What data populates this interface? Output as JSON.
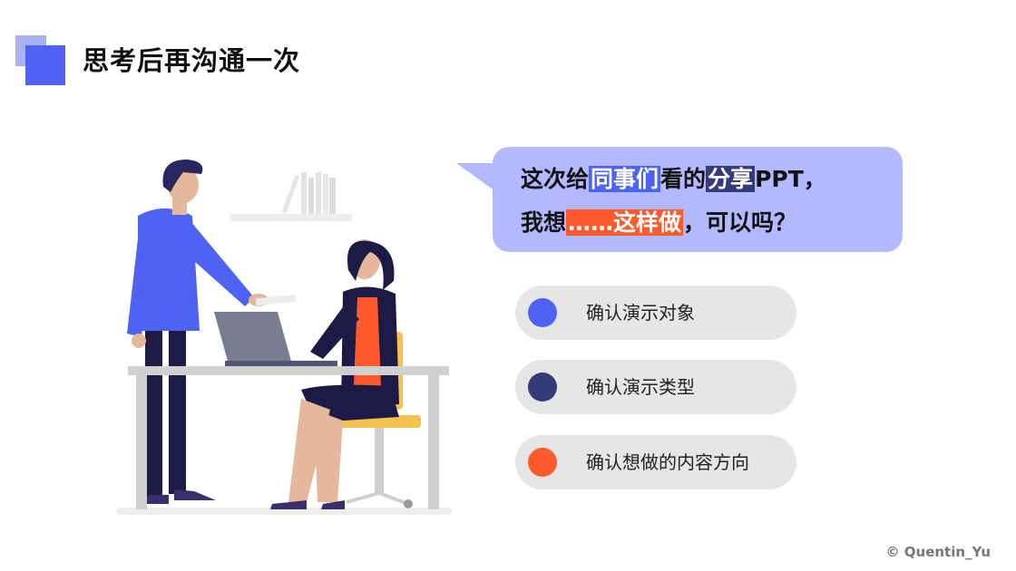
{
  "title": "思考后再沟通一次",
  "bubble": {
    "line1": [
      {
        "text": "这次给"
      },
      {
        "text": "同事们",
        "highlight": "blue"
      },
      {
        "text": "看的"
      },
      {
        "text": "分享",
        "highlight": "navy"
      },
      {
        "text": "PPT，"
      }
    ],
    "line2": [
      {
        "text": "我想"
      },
      {
        "text": "……这样做",
        "highlight": "orange"
      },
      {
        "text": "，可以吗？"
      }
    ]
  },
  "options": [
    {
      "label": "确认演示对象",
      "color": "#4f63f3"
    },
    {
      "label": "确认演示类型",
      "color": "#343b76"
    },
    {
      "label": "确认想做的内容方向",
      "color": "#fe5a2b"
    }
  ],
  "copyright": "© Quentin_Yu",
  "colors": {
    "primary": "#4f63f3",
    "navy": "#343b76",
    "orange": "#fe5a2b",
    "bubble": "#b2b9ff"
  }
}
